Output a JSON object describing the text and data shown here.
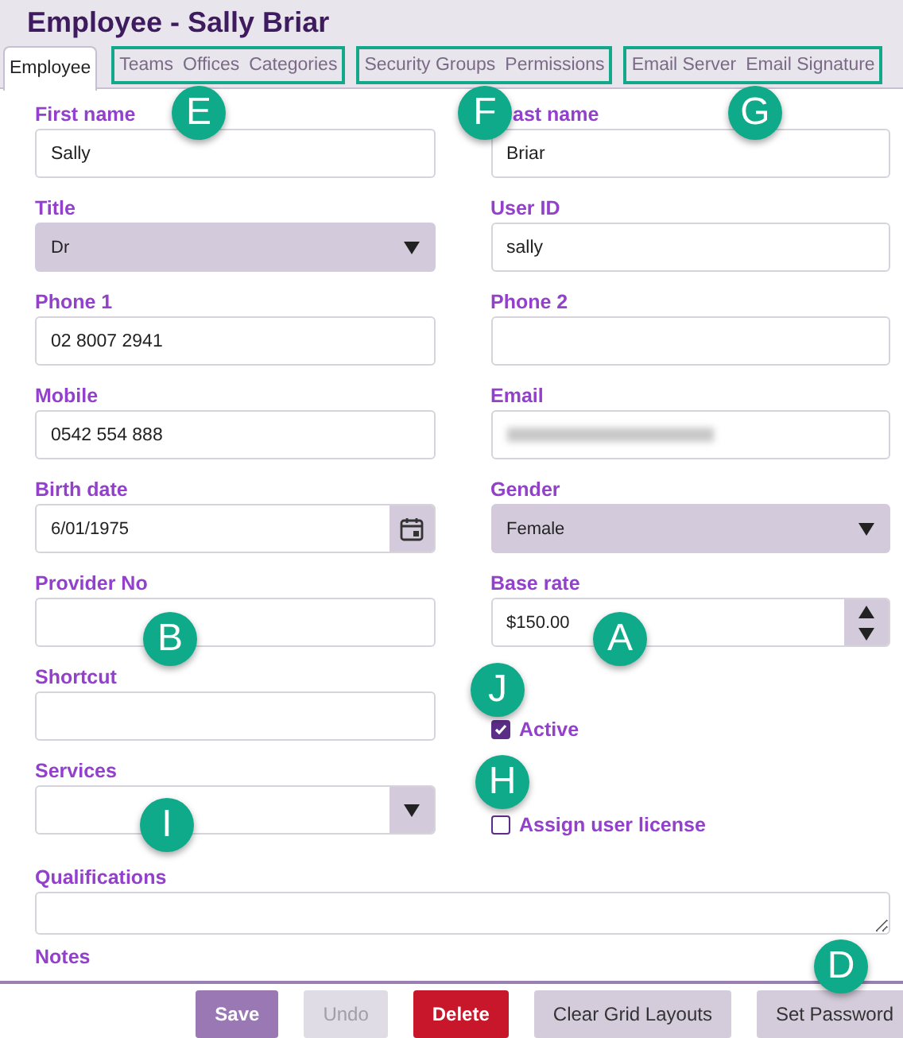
{
  "window": {
    "title": "Employee - Sally Briar"
  },
  "tab_groups": [
    {
      "outlined": false,
      "tabs": [
        {
          "label": "Employee",
          "selected": true
        }
      ]
    },
    {
      "outlined": true,
      "tabs": [
        {
          "label": "Teams",
          "selected": false
        },
        {
          "label": "Offices",
          "selected": false
        },
        {
          "label": "Categories",
          "selected": false
        }
      ]
    },
    {
      "outlined": true,
      "tabs": [
        {
          "label": "Security Groups",
          "selected": false
        },
        {
          "label": "Permissions",
          "selected": false
        }
      ]
    },
    {
      "outlined": true,
      "tabs": [
        {
          "label": "Email Server",
          "selected": false
        },
        {
          "label": "Email Signature",
          "selected": false
        }
      ]
    }
  ],
  "left_fields": [
    {
      "kind": "text",
      "label": "First name",
      "value": "Sally"
    },
    {
      "kind": "select",
      "label": "Title",
      "value": "Dr"
    },
    {
      "kind": "text",
      "label": "Phone 1",
      "value": "02 8007 2941"
    },
    {
      "kind": "text",
      "label": "Mobile",
      "value": "0542 554 888"
    },
    {
      "kind": "date",
      "label": "Birth date",
      "value": "6/01/1975"
    },
    {
      "kind": "text",
      "label": "Provider No"
    },
    {
      "kind": "text",
      "label": "Shortcut"
    },
    {
      "kind": "combo",
      "label": "Services"
    }
  ],
  "right_fields": [
    {
      "kind": "text",
      "label": "ast name",
      "indented": true,
      "value": "Briar"
    },
    {
      "kind": "text",
      "label": "User ID",
      "value": "sally"
    },
    {
      "kind": "text",
      "label": "Phone 2"
    },
    {
      "kind": "text",
      "label": "Email",
      "redacted": true
    },
    {
      "kind": "select",
      "label": "Gender",
      "value": "Female"
    },
    {
      "kind": "number",
      "label": "Base rate",
      "value": "$150.00"
    },
    {
      "kind": "checkbox",
      "label": "Active",
      "checked": true
    },
    {
      "kind": "checkbox",
      "label": "Assign user license",
      "checked": false
    }
  ],
  "qualifications": {
    "label": "Qualifications"
  },
  "notes": {
    "label": "Notes"
  },
  "buttons": [
    {
      "label": "Save",
      "kind": "primary",
      "disabled": false
    },
    {
      "label": "Undo",
      "kind": "secondary",
      "disabled": true
    },
    {
      "label": "Delete",
      "kind": "danger",
      "disabled": false
    },
    {
      "label": "Clear Grid Layouts",
      "kind": "secondary",
      "disabled": false
    },
    {
      "label": "Set Password",
      "kind": "secondary",
      "disabled": false
    }
  ],
  "callouts": [
    {
      "letter": "E"
    },
    {
      "letter": "F"
    },
    {
      "letter": "G"
    },
    {
      "letter": "B"
    },
    {
      "letter": "A"
    },
    {
      "letter": "J"
    },
    {
      "letter": "H"
    },
    {
      "letter": "I"
    },
    {
      "letter": "D"
    }
  ]
}
